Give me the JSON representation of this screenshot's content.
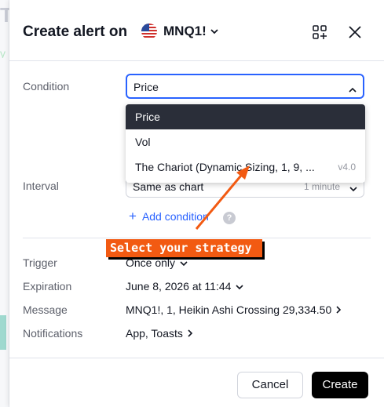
{
  "background": {
    "peek_text": "T"
  },
  "header": {
    "title": "Create alert on",
    "symbol": "MNQ1!",
    "flag_icon": "us-flag-icon"
  },
  "condition": {
    "label": "Condition",
    "selected": "Price",
    "options": [
      {
        "label": "Price",
        "version": ""
      },
      {
        "label": "Vol",
        "version": ""
      },
      {
        "label": "The Chariot (Dynamic Sizing, 1, 9, ...",
        "version": "v4.0"
      }
    ]
  },
  "interval": {
    "label": "Interval",
    "value": "Same as chart",
    "right_value": "1 minute"
  },
  "add_condition": {
    "label": "Add condition",
    "help": "?"
  },
  "annotation": {
    "text": "Select your strategy"
  },
  "trigger": {
    "label": "Trigger",
    "value": "Once only"
  },
  "expiration": {
    "label": "Expiration",
    "value": "June 8, 2026 at 11:44"
  },
  "message": {
    "label": "Message",
    "value": "MNQ1!, 1, Heikin Ashi Crossing 29,334.50"
  },
  "notifications": {
    "label": "Notifications",
    "value": "App, Toasts"
  },
  "footer": {
    "cancel": "Cancel",
    "create": "Create"
  },
  "colors": {
    "accent": "#2962ff",
    "annotation": "#f25a12",
    "primary_button": "#000000",
    "active_option": "#2a2e39"
  }
}
